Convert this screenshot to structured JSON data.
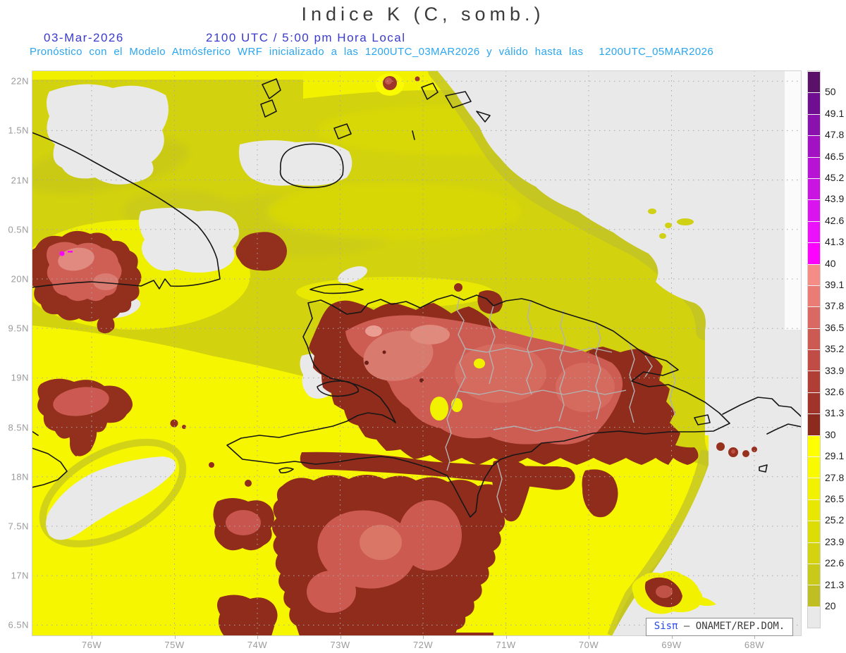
{
  "title": "Indice K (C, somb.)",
  "header": {
    "date": "03-Mar-2026",
    "local_time": "2100 UTC / 5:00 pm Hora Local",
    "model_line": "Pronóstico con el Modelo Atmósferico WRF inicializado a las 1200UTC_03MAR2026 y válido hasta las",
    "valid_until": "1200UTC_05MAR2026"
  },
  "colors": {
    "title_text": "#3b3b3b",
    "header_blue": "#3a3ace",
    "header_cyan": "#2aa6f0",
    "axis_label": "#9b9b9b",
    "below_scale_gray": "#e9e9e9",
    "field_olive": "#d2d20e",
    "field_bright_yellow": "#f6f600",
    "k30_dark_red": "#8c2a1e",
    "k35_salmon": "#cc5a52",
    "k40_magenta": "#fa04fe"
  },
  "axes": {
    "lat_labels": [
      "22N",
      "1.5N",
      "21N",
      "0.5N",
      "20N",
      "9.5N",
      "19N",
      "8.5N",
      "18N",
      "7.5N",
      "17N",
      "6.5N"
    ],
    "lon_labels": [
      "76W",
      "75W",
      "74W",
      "73W",
      "72W",
      "71W",
      "70W",
      "69W",
      "68W"
    ]
  },
  "colorbar": {
    "tick_labels": [
      "50",
      "49.1",
      "47.8",
      "46.5",
      "45.2",
      "43.9",
      "42.6",
      "41.3",
      "40",
      "39.1",
      "37.8",
      "36.5",
      "35.2",
      "33.9",
      "32.6",
      "31.3",
      "30",
      "29.1",
      "27.8",
      "26.5",
      "25.2",
      "23.9",
      "22.6",
      "21.3",
      "20"
    ],
    "segment_colors": [
      "#5a1168",
      "#6f0e90",
      "#8a11ae",
      "#a212c2",
      "#b713d4",
      "#ca14e2",
      "#da14ee",
      "#ea12f8",
      "#fa04fe",
      "#f48d86",
      "#ea7b75",
      "#db6963",
      "#cc5a52",
      "#c04c45",
      "#b13e35",
      "#a1342a",
      "#8c2a1e",
      "#ffff00",
      "#f9f900",
      "#f1f100",
      "#e7e700",
      "#dddd06",
      "#d3d310",
      "#c9c91a",
      "#bfbf24",
      "#e9e9e9"
    ]
  },
  "watermark": {
    "brand": "Sisπ",
    "separator": "–",
    "org": "ONAMET/REP.DOM."
  }
}
